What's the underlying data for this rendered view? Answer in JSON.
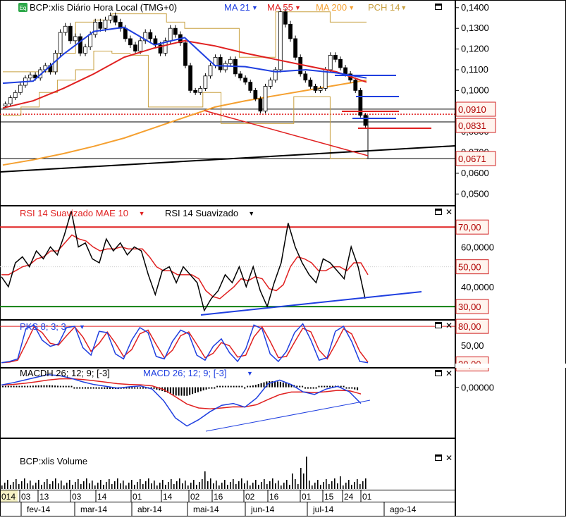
{
  "main": {
    "badge": "Eq",
    "instrument": "BCP:xlis Diário Hora Local (TMG+0)",
    "legend": [
      {
        "label": "MA 21",
        "color": "#1f3fe0"
      },
      {
        "label": "MA 55",
        "color": "#e02020"
      },
      {
        "label": "MA 200",
        "color": "#f5a030"
      },
      {
        "label": "PCH 14",
        "color": "#c8a040"
      }
    ],
    "y_ticks": [
      "0,1400",
      "0,1300",
      "0,1200",
      "0,1100",
      "0,1000",
      "0,0900",
      "0,0800",
      "0,0700",
      "0,0600",
      "0,0500"
    ],
    "price_tags": [
      {
        "label": "0,0910",
        "value": 0.091
      },
      {
        "label": "0,0831",
        "value": 0.0831
      },
      {
        "label": "0,0671",
        "value": 0.0671
      }
    ]
  },
  "rsi": {
    "legend": [
      {
        "label": "RSI 14 Suavizado MAE 10",
        "color": "#e02020"
      },
      {
        "label": "RSI 14 Suavizado",
        "color": "#000000"
      }
    ],
    "y_ticks": [
      "70,00",
      "60,0000",
      "50,00",
      "40,0000",
      "30,00"
    ]
  },
  "stoch": {
    "legend": [
      {
        "label": "PKS 8; 3; 3",
        "color": "#1f3fe0"
      }
    ],
    "y_ticks": [
      "80,00",
      "50,00",
      "20,00"
    ]
  },
  "macd": {
    "legend": [
      {
        "label": "MACDH 26; 12; 9; [-3]",
        "color": "#000000"
      },
      {
        "label": "MACD 26; 12; 9; [-3]",
        "color": "#1f3fe0"
      }
    ],
    "y_ticks": [
      "0,00000"
    ]
  },
  "volume": {
    "legend": [
      {
        "label": "BCP:xlis Volume",
        "color": "#000000"
      }
    ]
  },
  "x_axis": {
    "days": [
      "014",
      "03",
      "13",
      "03",
      "14",
      "01",
      "14",
      "02",
      "16",
      "02",
      "16",
      "01",
      "15",
      "24",
      "01"
    ],
    "months": [
      "fev-14",
      "mar-14",
      "abr-14",
      "mai-14",
      "jun-14",
      "jul-14",
      "ago-14"
    ]
  },
  "colors": {
    "ma21": "#1f3fe0",
    "ma55": "#e02020",
    "ma200": "#f5a030",
    "pch": "#c8a040",
    "tag_border": "#d02020",
    "tag_bg": "#fff4ee",
    "rsi_upper": "#e02020",
    "rsi_lower": "#108010"
  },
  "chart_data": [
    {
      "type": "line",
      "title": "BCP:xlis Diário Hora Local (TMG+0)",
      "ylim": [
        0.045,
        0.143
      ],
      "series": [
        {
          "name": "MA 21",
          "x": [
            0,
            10,
            20,
            30,
            40,
            50,
            60,
            70,
            80,
            90,
            100,
            110,
            120
          ],
          "values": [
            0.1035,
            0.1045,
            0.1175,
            0.1285,
            0.1305,
            0.122,
            0.1255,
            0.112,
            0.1115,
            0.109,
            0.11,
            0.1085,
            0.106
          ]
        },
        {
          "name": "MA 55",
          "x": [
            0,
            10,
            20,
            30,
            40,
            50,
            60,
            70,
            80,
            90,
            100,
            110,
            120
          ],
          "values": [
            0.0915,
            0.095,
            0.101,
            0.108,
            0.116,
            0.1205,
            0.124,
            0.1215,
            0.118,
            0.115,
            0.112,
            0.109,
            0.104
          ]
        },
        {
          "name": "MA 200",
          "x": [
            0,
            10,
            20,
            30,
            40,
            50,
            60,
            70,
            80,
            90,
            100,
            110,
            120
          ],
          "values": [
            0.064,
            0.0665,
            0.0695,
            0.073,
            0.077,
            0.082,
            0.087,
            0.092,
            0.095,
            0.0975,
            0.1,
            0.1025,
            0.105
          ]
        }
      ],
      "closes": [
        0.0935,
        0.0965,
        0.099,
        0.1025,
        0.106,
        0.1075,
        0.106,
        0.11,
        0.112,
        0.109,
        0.118,
        0.128,
        0.131,
        0.124,
        0.126,
        0.118,
        0.121,
        0.127,
        0.133,
        0.13,
        0.134,
        0.136,
        0.133,
        0.13,
        0.125,
        0.122,
        0.119,
        0.124,
        0.128,
        0.125,
        0.122,
        0.118,
        0.124,
        0.13,
        0.127,
        0.123,
        0.112,
        0.1,
        0.099,
        0.101,
        0.107,
        0.112,
        0.116,
        0.11,
        0.113,
        0.115,
        0.108,
        0.106,
        0.104,
        0.1,
        0.096,
        0.09,
        0.102,
        0.105,
        0.11,
        0.138,
        0.132,
        0.125,
        0.116,
        0.108,
        0.105,
        0.102,
        0.1,
        0.101,
        0.11,
        0.117,
        0.115,
        0.111,
        0.108,
        0.105,
        0.1,
        0.088,
        0.0831
      ],
      "pch_upper": [
        0.109,
        0.109,
        0.109,
        0.118,
        0.133,
        0.134,
        0.137,
        0.137,
        0.137,
        0.133,
        0.13,
        0.13,
        0.13,
        0.116,
        0.116,
        0.138,
        0.138,
        0.138,
        0.133,
        0.133
      ],
      "pch_lower": [
        0.088,
        0.092,
        0.099,
        0.105,
        0.11,
        0.119,
        0.118,
        0.117,
        0.092,
        0.092,
        0.092,
        0.099,
        0.084,
        0.084,
        0.084,
        0.084,
        0.097,
        0.097,
        0.067,
        0.067
      ]
    },
    {
      "type": "line",
      "title": "RSI 14 Suavizado",
      "ylim": [
        24,
        80
      ],
      "series": [
        {
          "name": "RSI 14 Suavizado",
          "values": [
            45,
            40,
            52,
            55,
            50,
            58,
            54,
            60,
            56,
            66,
            78,
            60,
            62,
            54,
            52,
            64,
            58,
            62,
            56,
            60,
            58,
            46,
            36,
            48,
            50,
            42,
            50,
            46,
            42,
            28,
            34,
            38,
            46,
            42,
            50,
            40,
            50,
            38,
            30,
            42,
            52,
            72,
            60,
            52,
            46,
            42,
            54,
            52,
            48,
            44,
            60,
            50,
            34
          ]
        },
        {
          "name": "RSI 14 Suavizado MAE 10",
          "values": [
            46,
            46,
            48,
            50,
            51,
            54,
            55,
            58,
            58,
            62,
            66,
            64,
            63,
            60,
            58,
            59,
            59,
            60,
            59,
            59,
            59,
            55,
            50,
            48,
            48,
            46,
            46,
            46,
            44,
            38,
            35,
            34,
            37,
            40,
            44,
            43,
            45,
            44,
            39,
            38,
            41,
            50,
            55,
            54,
            52,
            48,
            48,
            50,
            50,
            48,
            52,
            52,
            46
          ]
        }
      ]
    },
    {
      "type": "line",
      "title": "PKS 8; 3; 3",
      "ylim": [
        15,
        88
      ],
      "series": [
        {
          "name": "PKS 8; 3; 3",
          "values": [
            22,
            24,
            28,
            76,
            82,
            58,
            48,
            52,
            78,
            80,
            46,
            34,
            72,
            70,
            36,
            28,
            58,
            78,
            70,
            32,
            28,
            56,
            74,
            68,
            34,
            26,
            48,
            60,
            38,
            24,
            44,
            82,
            76,
            36,
            24,
            40,
            70,
            84,
            58,
            26,
            30,
            72,
            80,
            56,
            24,
            22
          ]
        }
      ]
    },
    {
      "type": "line",
      "title": "MACD 26; 12; 9; [-3]",
      "ylim": [
        -0.011,
        0.004
      ],
      "series": [
        {
          "name": "MACD 26; 12; 9; [-3]",
          "values": [
            0.0005,
            0.001,
            0.0016,
            0.0022,
            0.0028,
            0.0026,
            0.002,
            0.0012,
            0.0006,
            0.0002,
            -0.0002,
            0.0001,
            0.0003,
            -0.0004,
            -0.003,
            -0.0068,
            -0.0086,
            -0.0072,
            -0.0054,
            -0.004,
            -0.0036,
            -0.0044,
            -0.0024,
            0.0008,
            0.0016,
            0.0006,
            -0.001,
            -0.0016,
            -0.0004,
            0.0002,
            -0.001,
            -0.0036
          ]
        }
      ]
    }
  ]
}
